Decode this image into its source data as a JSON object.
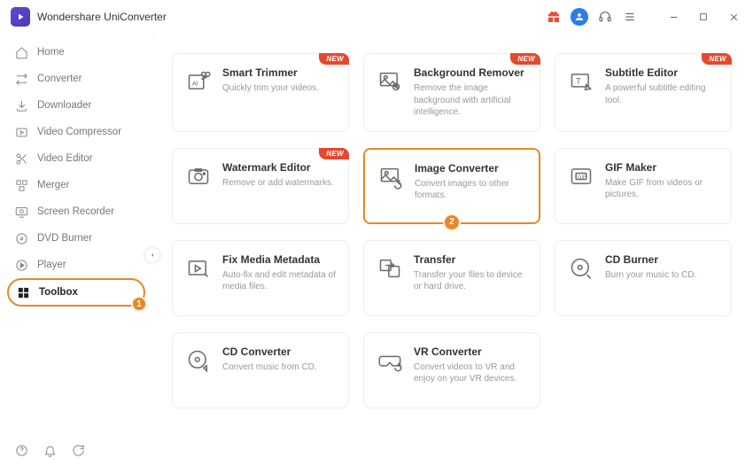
{
  "app_title": "Wondershare UniConverter",
  "new_badge": "NEW",
  "sidebar": {
    "items": [
      {
        "label": "Home"
      },
      {
        "label": "Converter"
      },
      {
        "label": "Downloader"
      },
      {
        "label": "Video Compressor"
      },
      {
        "label": "Video Editor"
      },
      {
        "label": "Merger"
      },
      {
        "label": "Screen Recorder"
      },
      {
        "label": "DVD Burner"
      },
      {
        "label": "Player"
      },
      {
        "label": "Toolbox"
      }
    ]
  },
  "callouts": {
    "one": "1",
    "two": "2"
  },
  "tools": [
    {
      "title": "Smart Trimmer",
      "desc": "Quickly trim your videos.",
      "new": true
    },
    {
      "title": "Background Remover",
      "desc": "Remove the image background with artificial intelligence.",
      "new": true
    },
    {
      "title": "Subtitle Editor",
      "desc": "A powerful subtitle editing tool.",
      "new": true
    },
    {
      "title": "Watermark Editor",
      "desc": "Remove or add watermarks.",
      "new": true
    },
    {
      "title": "Image Converter",
      "desc": "Convert images to other formats.",
      "new": false,
      "highlight": true
    },
    {
      "title": "GIF Maker",
      "desc": "Make GIF from videos or pictures.",
      "new": false
    },
    {
      "title": "Fix Media Metadata",
      "desc": "Auto-fix and edit metadata of media files.",
      "new": false
    },
    {
      "title": "Transfer",
      "desc": "Transfer your files to device or hard drive.",
      "new": false
    },
    {
      "title": "CD Burner",
      "desc": "Burn your music to CD.",
      "new": false
    },
    {
      "title": "CD Converter",
      "desc": "Convert music from CD.",
      "new": false
    },
    {
      "title": "VR Converter",
      "desc": "Convert videos to VR and enjoy on your VR devices.",
      "new": false
    }
  ]
}
